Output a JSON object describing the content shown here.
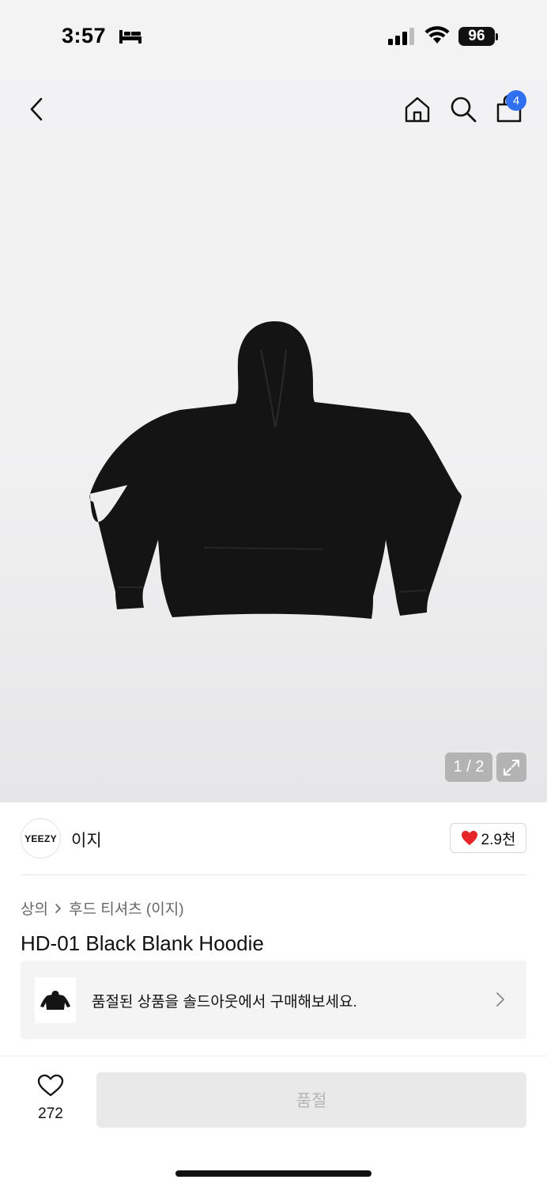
{
  "status_bar": {
    "time": "3:57",
    "battery": "96"
  },
  "nav": {
    "cart_count": "4"
  },
  "gallery": {
    "pager": "1 / 2"
  },
  "brand": {
    "logo_text": "YEEZY",
    "name": "이지",
    "like_count": "2.9천"
  },
  "breadcrumb": {
    "category": "상의",
    "subcategory": "후드 티셔츠 (이지)"
  },
  "product": {
    "title": "HD-01 Black Blank Hoodie"
  },
  "soldout_banner": {
    "text": "품절된 상품을 솔드아웃에서 구매해보세요."
  },
  "bottom_bar": {
    "wish_count": "272",
    "buy_label": "품절"
  },
  "colors": {
    "badge": "#2f6ff0",
    "heart": "#e8242b",
    "hoodie": "#141414"
  }
}
